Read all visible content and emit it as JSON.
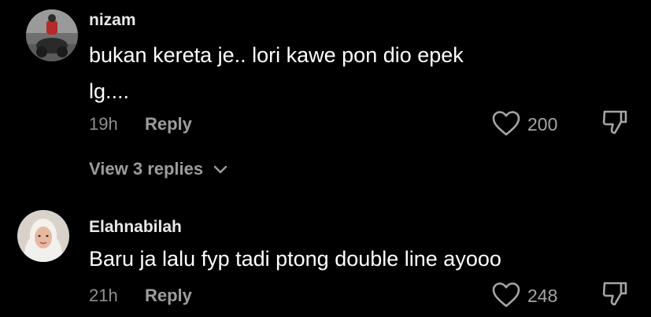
{
  "comments": [
    {
      "username": "nizam",
      "text_lines": [
        "bukan kereta je.. lori kawe pon dio epek",
        "lg...."
      ],
      "time": "19h",
      "reply_label": "Reply",
      "likes": "200",
      "view_replies": "View 3 replies"
    },
    {
      "username": "Elahnabilah",
      "text_lines": [
        "Baru ja lalu fyp tadi ptong double line ayooo"
      ],
      "time": "21h",
      "reply_label": "Reply",
      "likes": "248"
    }
  ],
  "colors": {
    "background": "#000000",
    "text": "#ffffff",
    "muted": "#9d9d9d"
  },
  "icons": [
    "heart-icon",
    "dislike-icon",
    "chevron-down-icon"
  ]
}
